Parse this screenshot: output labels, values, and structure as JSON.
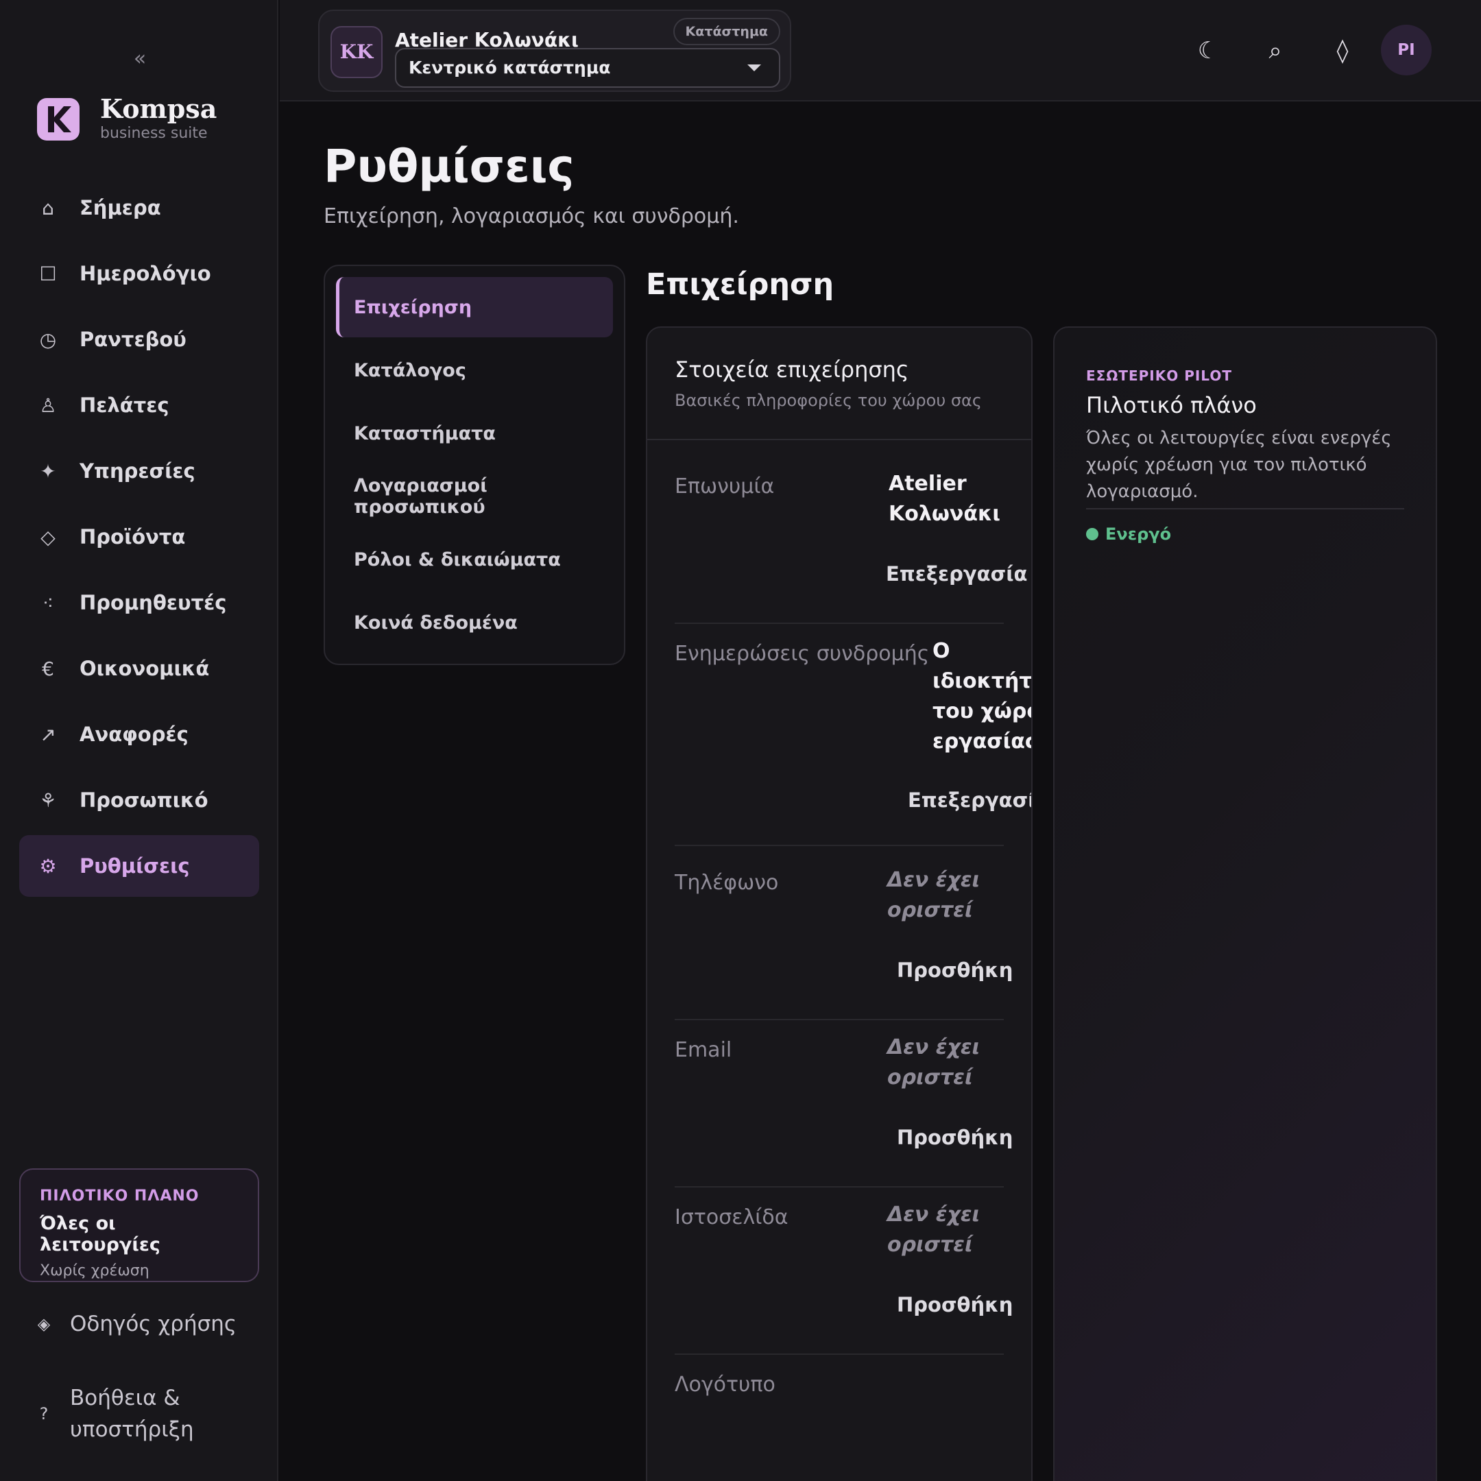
{
  "sidebar": {
    "collapse_icon": "«",
    "brand": {
      "name": "Kompsa",
      "subtitle": "business suite",
      "logo_icon": "kompsa-logo"
    },
    "nav": [
      {
        "label": "Σήμερα",
        "icon": "⌂"
      },
      {
        "label": "Ημερολόγιο",
        "icon": "☐"
      },
      {
        "label": "Ραντεβού",
        "icon": "◷"
      },
      {
        "label": "Πελάτες",
        "icon": "♙"
      },
      {
        "label": "Υπηρεσίες",
        "icon": "✦"
      },
      {
        "label": "Προϊόντα",
        "icon": "◇"
      },
      {
        "label": "Προμηθευτές",
        "icon": "⁖"
      },
      {
        "label": "Οικονομικά",
        "icon": "€"
      },
      {
        "label": "Αναφορές",
        "icon": "↗"
      },
      {
        "label": "Προσωπικό",
        "icon": "⚘"
      },
      {
        "label": "Ρυθμίσεις",
        "icon": "⚙",
        "active": true
      }
    ],
    "pilot_card": {
      "kicker": "ΠΙΛΟΤΙΚΟ ΠΛΑΝΟ",
      "title": "Όλες οι λειτουργίες",
      "subtitle": "Χωρίς χρέωση"
    },
    "guide": {
      "label": "Οδηγός χρήσης",
      "icon": "◈"
    },
    "help": {
      "label_line1": "Βοήθεια &",
      "label_line2": "υποστήριξη",
      "icon": "?"
    }
  },
  "topbar": {
    "store": {
      "initials": "KK",
      "name": "Atelier Κολωνάκι",
      "badge": "Κατάστημα",
      "selected": "Κεντρικό κατάστημα"
    },
    "icons": {
      "theme": "☾",
      "search": "⌕",
      "diamond": "◊"
    },
    "user_initials": "PI"
  },
  "page": {
    "title": "Ρυθμίσεις",
    "subtitle": "Επιχείρηση, λογαριασμός και συνδρομή."
  },
  "settings_nav": [
    {
      "label": "Επιχείρηση",
      "active": true
    },
    {
      "label": "Κατάλογος"
    },
    {
      "label": "Καταστήματα"
    },
    {
      "label": "Λογαριασμοί προσωπικού"
    },
    {
      "label": "Ρόλοι & δικαιώματα"
    },
    {
      "label": "Κοινά δεδομένα"
    }
  ],
  "section": {
    "title": "Επιχείρηση",
    "card": {
      "title": "Στοιχεία επιχείρησης",
      "subtitle": "Βασικές πληροφορίες του χώρου σας",
      "fields": [
        {
          "label": "Επωνυμία",
          "value_line1": "Atelier",
          "value_line2": "Κολωνάκι",
          "action": "Επεξεργασία"
        },
        {
          "label": "Ενημερώσεις συνδρομής",
          "value_line1": "Ο",
          "value_line2": "ιδιοκτήτης",
          "value_line3": "του χώρου",
          "value_line4": "εργασίας",
          "action": "Επεξεργασία"
        },
        {
          "label": "Τηλέφωνο",
          "value_line1": "Δεν έχει",
          "value_line2": "οριστεί",
          "action": "Προσθήκη"
        },
        {
          "label": "Email",
          "value_line1": "Δεν έχει",
          "value_line2": "οριστεί",
          "action": "Προσθήκη"
        },
        {
          "label": "Ιστοσελίδα",
          "value_line1": "Δεν έχει",
          "value_line2": "οριστεί",
          "action": "Προσθήκη"
        },
        {
          "label": "Λογότυπο"
        }
      ]
    },
    "plan": {
      "kicker": "ΕΣΩΤΕΡΙΚΟ PILOT",
      "title": "Πιλοτικό πλάνο",
      "description": "Όλες οι λειτουργίες είναι ενεργές χωρίς χρέωση για τον πιλοτικό λογαριασμό.",
      "status": "Ενεργό",
      "status_color": "#5fc08e"
    }
  }
}
